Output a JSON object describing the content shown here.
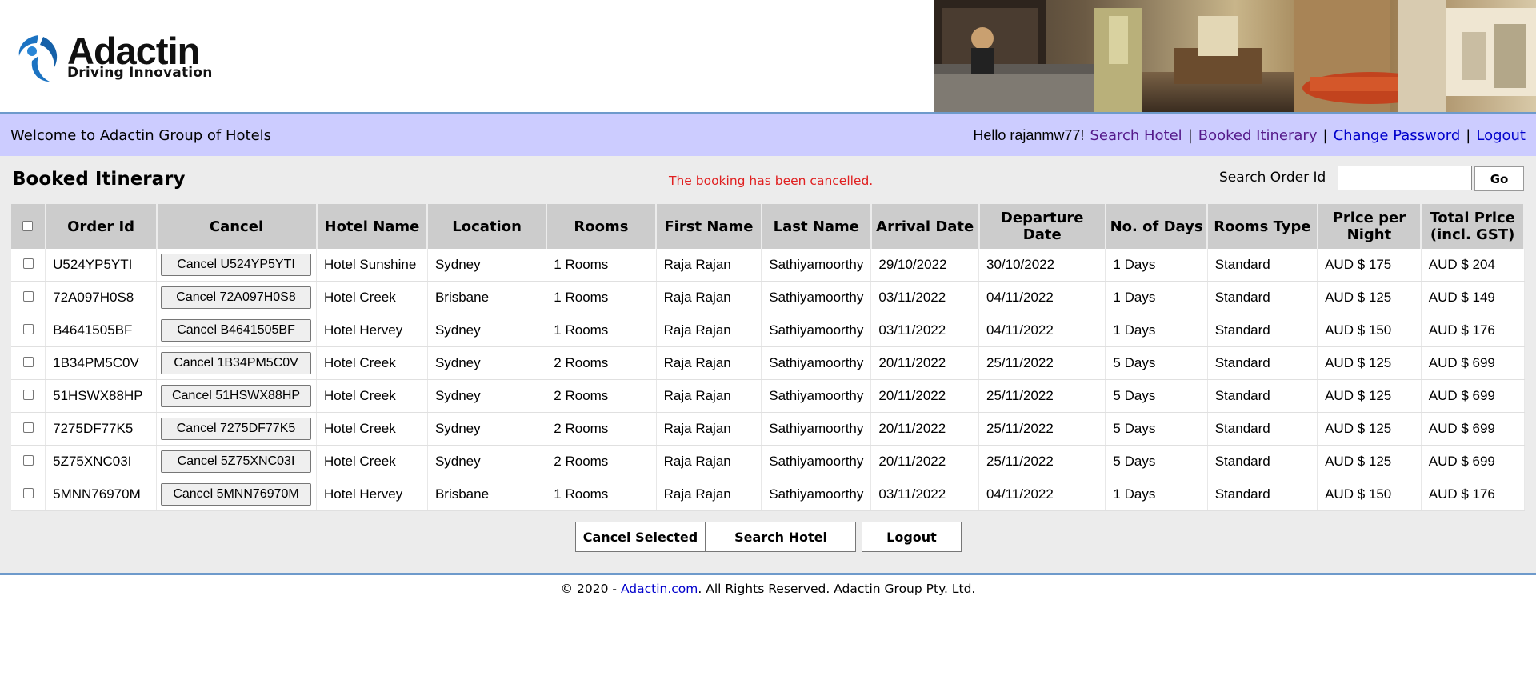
{
  "logo": {
    "title": "Adactin",
    "tagline": "Driving Innovation"
  },
  "welcome": {
    "text": "Welcome to Adactin Group of Hotels",
    "hello": "Hello rajanmw77!",
    "links": [
      "Search Hotel",
      "Booked Itinerary",
      "Change Password",
      "Logout"
    ]
  },
  "main": {
    "title": "Booked Itinerary",
    "status": "The booking has been cancelled.",
    "search_label": "Search Order Id",
    "go_label": "Go"
  },
  "table": {
    "headers": [
      "Order Id",
      "Cancel",
      "Hotel Name",
      "Location",
      "Rooms",
      "First Name",
      "Last Name",
      "Arrival Date",
      "Departure Date",
      "No. of Days",
      "Rooms Type",
      "Price per Night",
      "Total Price (incl. GST)"
    ],
    "rows": [
      {
        "order_id": "U524YP5YTI",
        "cancel": "Cancel U524YP5YTI",
        "hotel": "Hotel Sunshine",
        "location": "Sydney",
        "rooms": "1 Rooms",
        "first": "Raja Rajan",
        "last": "Sathiyamoorthy",
        "arrival": "29/10/2022",
        "departure": "30/10/2022",
        "days": "1 Days",
        "type": "Standard",
        "ppn": "AUD $ 175",
        "total": "AUD $ 204"
      },
      {
        "order_id": "72A097H0S8",
        "cancel": "Cancel 72A097H0S8",
        "hotel": "Hotel Creek",
        "location": "Brisbane",
        "rooms": "1 Rooms",
        "first": "Raja Rajan",
        "last": "Sathiyamoorthy",
        "arrival": "03/11/2022",
        "departure": "04/11/2022",
        "days": "1 Days",
        "type": "Standard",
        "ppn": "AUD $ 125",
        "total": "AUD $ 149"
      },
      {
        "order_id": "B4641505BF",
        "cancel": "Cancel B4641505BF",
        "hotel": "Hotel Hervey",
        "location": "Sydney",
        "rooms": "1 Rooms",
        "first": "Raja Rajan",
        "last": "Sathiyamoorthy",
        "arrival": "03/11/2022",
        "departure": "04/11/2022",
        "days": "1 Days",
        "type": "Standard",
        "ppn": "AUD $ 150",
        "total": "AUD $ 176"
      },
      {
        "order_id": "1B34PM5C0V",
        "cancel": "Cancel 1B34PM5C0V",
        "hotel": "Hotel Creek",
        "location": "Sydney",
        "rooms": "2 Rooms",
        "first": "Raja Rajan",
        "last": "Sathiyamoorthy",
        "arrival": "20/11/2022",
        "departure": "25/11/2022",
        "days": "5 Days",
        "type": "Standard",
        "ppn": "AUD $ 125",
        "total": "AUD $ 699"
      },
      {
        "order_id": "51HSWX88HP",
        "cancel": "Cancel 51HSWX88HP",
        "hotel": "Hotel Creek",
        "location": "Sydney",
        "rooms": "2 Rooms",
        "first": "Raja Rajan",
        "last": "Sathiyamoorthy",
        "arrival": "20/11/2022",
        "departure": "25/11/2022",
        "days": "5 Days",
        "type": "Standard",
        "ppn": "AUD $ 125",
        "total": "AUD $ 699"
      },
      {
        "order_id": "7275DF77K5",
        "cancel": "Cancel 7275DF77K5",
        "hotel": "Hotel Creek",
        "location": "Sydney",
        "rooms": "2 Rooms",
        "first": "Raja Rajan",
        "last": "Sathiyamoorthy",
        "arrival": "20/11/2022",
        "departure": "25/11/2022",
        "days": "5 Days",
        "type": "Standard",
        "ppn": "AUD $ 125",
        "total": "AUD $ 699"
      },
      {
        "order_id": "5Z75XNC03I",
        "cancel": "Cancel 5Z75XNC03I",
        "hotel": "Hotel Creek",
        "location": "Sydney",
        "rooms": "2 Rooms",
        "first": "Raja Rajan",
        "last": "Sathiyamoorthy",
        "arrival": "20/11/2022",
        "departure": "25/11/2022",
        "days": "5 Days",
        "type": "Standard",
        "ppn": "AUD $ 125",
        "total": "AUD $ 699"
      },
      {
        "order_id": "5MNN76970M",
        "cancel": "Cancel 5MNN76970M",
        "hotel": "Hotel Hervey",
        "location": "Brisbane",
        "rooms": "1 Rooms",
        "first": "Raja Rajan",
        "last": "Sathiyamoorthy",
        "arrival": "03/11/2022",
        "departure": "04/11/2022",
        "days": "1 Days",
        "type": "Standard",
        "ppn": "AUD $ 150",
        "total": "AUD $ 176"
      }
    ]
  },
  "actions": {
    "cancel_selected": "Cancel Selected",
    "search_hotel": "Search Hotel",
    "logout": "Logout"
  },
  "footer": {
    "prefix": "© 2020 - ",
    "link": "Adactin.com",
    "suffix": ". All Rights Reserved. Adactin Group Pty. Ltd."
  },
  "colors": {
    "welcome_bar": "#ccccff",
    "accent_line": "#6e9acb",
    "status_red": "#e02020",
    "logo_blue": "#1c73c2"
  }
}
